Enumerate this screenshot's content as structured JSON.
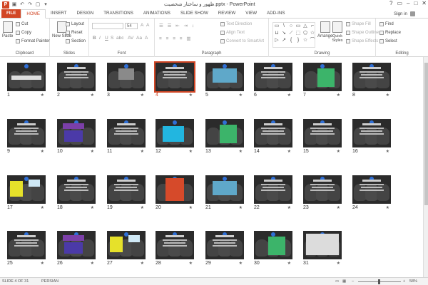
{
  "app": {
    "title": "ظهور و ساختار شخصیت.pptx - PowerPoint",
    "logo": "P",
    "window_controls": {
      "help": "?",
      "restore": "▭",
      "minimize": "–",
      "maximize": "□",
      "close": "✕"
    }
  },
  "tabs": [
    "FILE",
    "HOME",
    "INSERT",
    "DESIGN",
    "TRANSITIONS",
    "ANIMATIONS",
    "SLIDE SHOW",
    "REVIEW",
    "VIEW",
    "ADD-INS"
  ],
  "active_tab": "HOME",
  "signin": "Sign in",
  "ribbon": {
    "clipboard": {
      "paste": "Paste",
      "cut": "Cut",
      "copy": "Copy",
      "format_painter": "Format Painter",
      "label": "Clipboard"
    },
    "slides": {
      "new_slide": "New Slide",
      "layout": "Layout",
      "reset": "Reset",
      "section": "Section",
      "label": "Slides"
    },
    "font": {
      "size": "54",
      "label": "Font",
      "bold": "B",
      "italic": "I",
      "underline": "U",
      "strike": "S",
      "shadow": "abc",
      "spacing": "AV",
      "case": "Aa",
      "color": "A"
    },
    "paragraph": {
      "text_direction": "Text Direction",
      "align_text": "Align Text",
      "convert": "Convert to SmartArt",
      "label": "Paragraph"
    },
    "drawing": {
      "arrange": "Arrange",
      "quick_styles": "Quick Styles",
      "shape_fill": "Shape Fill",
      "shape_outline": "Shape Outline",
      "shape_effects": "Shape Effects",
      "label": "Drawing",
      "shapes": [
        "▭",
        "\\",
        "○",
        "▭",
        "△",
        "⌐",
        "⊔",
        "↘",
        "⟋",
        "⬚",
        "⬠",
        "☆",
        "▷",
        "↗",
        "{",
        "}",
        "☆",
        "⌒"
      ]
    },
    "editing": {
      "find": "Find",
      "replace": "Replace",
      "select": "Select",
      "label": "Editing"
    }
  },
  "slides": [
    {
      "n": "1",
      "accent": "title"
    },
    {
      "n": "2",
      "accent": "text"
    },
    {
      "n": "3",
      "accent": "box"
    },
    {
      "n": "4",
      "accent": "text"
    },
    {
      "n": "5",
      "accent": "blue"
    },
    {
      "n": "6",
      "accent": "text"
    },
    {
      "n": "7",
      "accent": "green"
    },
    {
      "n": "8",
      "accent": "text"
    },
    {
      "n": "9",
      "accent": "text"
    },
    {
      "n": "10",
      "accent": "purple"
    },
    {
      "n": "11",
      "accent": "text"
    },
    {
      "n": "12",
      "accent": "cyan"
    },
    {
      "n": "13",
      "accent": "green"
    },
    {
      "n": "14",
      "accent": "text"
    },
    {
      "n": "15",
      "accent": "text"
    },
    {
      "n": "16",
      "accent": "text"
    },
    {
      "n": "17",
      "accent": "yellow"
    },
    {
      "n": "18",
      "accent": "text"
    },
    {
      "n": "19",
      "accent": "text"
    },
    {
      "n": "20",
      "accent": "red"
    },
    {
      "n": "21",
      "accent": "blue"
    },
    {
      "n": "22",
      "accent": "text"
    },
    {
      "n": "23",
      "accent": "text"
    },
    {
      "n": "24",
      "accent": "text"
    },
    {
      "n": "25",
      "accent": "text"
    },
    {
      "n": "26",
      "accent": "purple"
    },
    {
      "n": "27",
      "accent": "yellow"
    },
    {
      "n": "28",
      "accent": "text"
    },
    {
      "n": "29",
      "accent": "text"
    },
    {
      "n": "30",
      "accent": "green"
    },
    {
      "n": "31",
      "accent": "photo"
    }
  ],
  "selected_slide": "4",
  "status": {
    "slide": "SLIDE 4 OF 31",
    "language": "PERSIAN",
    "zoom": "58%",
    "minus": "–",
    "plus": "+"
  },
  "colors": {
    "accent": "#d24726",
    "selection": "#d24726"
  }
}
